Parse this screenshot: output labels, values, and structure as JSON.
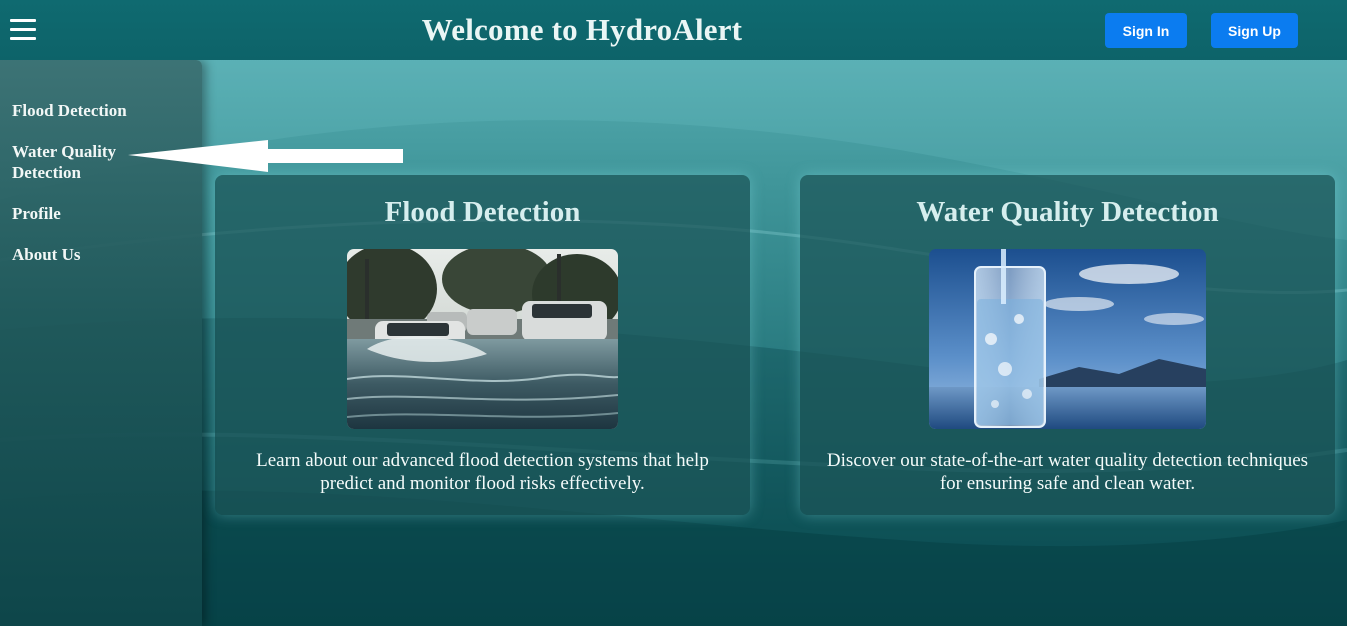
{
  "header": {
    "menu_icon": "hamburger-menu-icon",
    "title": "Welcome to HydroAlert",
    "sign_in_label": "Sign In",
    "sign_up_label": "Sign Up"
  },
  "sidebar": {
    "items": [
      {
        "label": "Flood Detection"
      },
      {
        "label": "Water Quality Detection"
      },
      {
        "label": "Profile"
      },
      {
        "label": "About Us"
      }
    ]
  },
  "annotation": {
    "icon": "left-arrow-icon",
    "points_to": "Water Quality Detection"
  },
  "cards": [
    {
      "title": "Flood Detection",
      "image": "flooded-street-image",
      "description": "Learn about our advanced flood detection systems that help predict and monitor flood risks effectively."
    },
    {
      "title": "Water Quality Detection",
      "image": "water-glass-image",
      "description": "Discover our state-of-the-art water quality detection techniques for ensuring safe and clean water."
    }
  ],
  "colors": {
    "header_bg": "#0f6a70",
    "button_bg": "#0b7cf0",
    "title_text": "#eaf6f5",
    "card_bg": "#1c5558"
  }
}
